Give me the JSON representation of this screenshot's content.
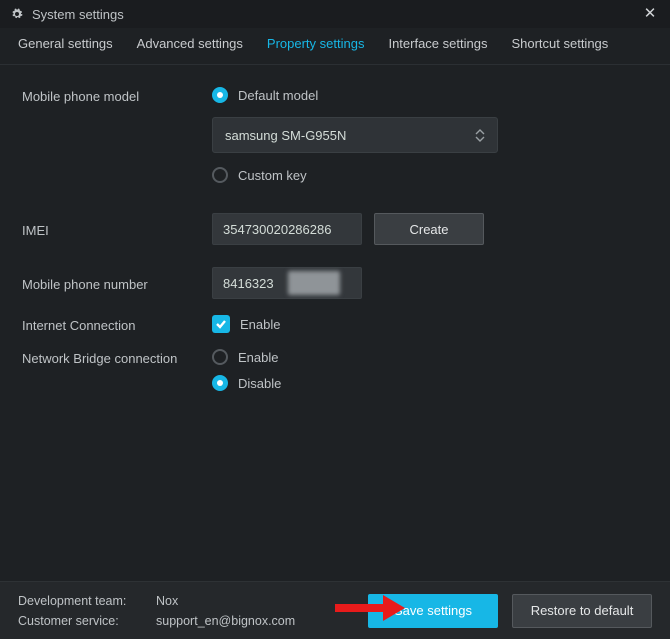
{
  "window": {
    "title": "System settings"
  },
  "tabs": [
    {
      "label": "General settings",
      "active": false
    },
    {
      "label": "Advanced settings",
      "active": false
    },
    {
      "label": "Property settings",
      "active": true
    },
    {
      "label": "Interface settings",
      "active": false
    },
    {
      "label": "Shortcut settings",
      "active": false
    }
  ],
  "form": {
    "model": {
      "label": "Mobile phone model",
      "option_default": "Default model",
      "option_custom": "Custom key",
      "selected": "default",
      "dropdown_value": "samsung SM-G955N"
    },
    "imei": {
      "label": "IMEI",
      "value": "354730020286286",
      "create_btn": "Create"
    },
    "phone": {
      "label": "Mobile phone number",
      "value": "8416323"
    },
    "internet": {
      "label": "Internet Connection",
      "enable_label": "Enable",
      "checked": true
    },
    "bridge": {
      "label": "Network Bridge connection",
      "enable_label": "Enable",
      "disable_label": "Disable",
      "selected": "disable"
    }
  },
  "footer": {
    "dev_team_label": "Development team:",
    "dev_team_value": "Nox",
    "cs_label": "Customer service:",
    "cs_value": "support_en@bignox.com",
    "save_btn": "Save settings",
    "restore_btn": "Restore to default"
  }
}
